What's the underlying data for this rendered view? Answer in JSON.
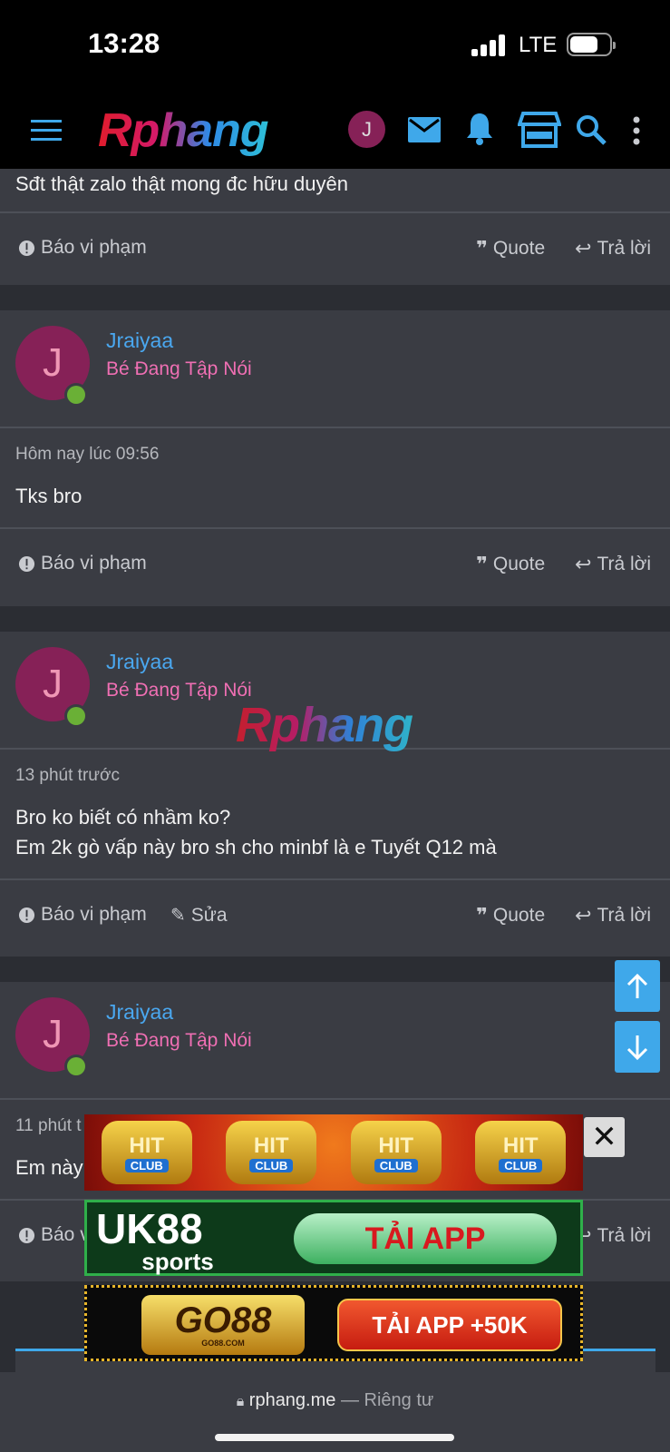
{
  "status": {
    "time": "13:28",
    "network": "LTE"
  },
  "nav": {
    "logo": "Rphang",
    "avatar_letter": "J"
  },
  "top_snippet": "Sđt thật zalo thật mong đc hữu duyên",
  "actions": {
    "report": "Báo vi phạm",
    "quote": "Quote",
    "reply": "Trả lời",
    "edit": "Sửa"
  },
  "posts": [
    {
      "avatar_letter": "J",
      "username": "Jraiyaa",
      "user_title": "Bé Đang Tập Nói",
      "time": "Hôm nay lúc 09:56",
      "lines": [
        "Tks bro"
      ]
    },
    {
      "avatar_letter": "J",
      "username": "Jraiyaa",
      "user_title": "Bé Đang Tập Nói",
      "time": "13 phút trước",
      "lines": [
        "Bro ko biết có nhầm ko?",
        "Em 2k gò vấp này bro sh cho minbf là e Tuyết Q12 mà"
      ]
    },
    {
      "avatar_letter": "J",
      "username": "Jraiyaa",
      "user_title": "Bé Đang Tập Nói",
      "time": "11 phút t",
      "lines": [
        "Em này"
      ],
      "report_partial": "Báo v"
    }
  ],
  "watermark": "Rphang",
  "ads": [
    {
      "name": "HIT CLUB",
      "labels": [
        "HIT",
        "CLUB"
      ]
    },
    {
      "name": "UK88 sports",
      "brand": "UK88",
      "sub": "sports",
      "cta": "TẢI APP"
    },
    {
      "name": "GO88",
      "brand": "GO88",
      "site": "GO88.COM",
      "cta": "TẢI APP +50K"
    }
  ],
  "browser": {
    "domain": "rphang.me",
    "separator": "—",
    "mode": "Riêng tư"
  }
}
